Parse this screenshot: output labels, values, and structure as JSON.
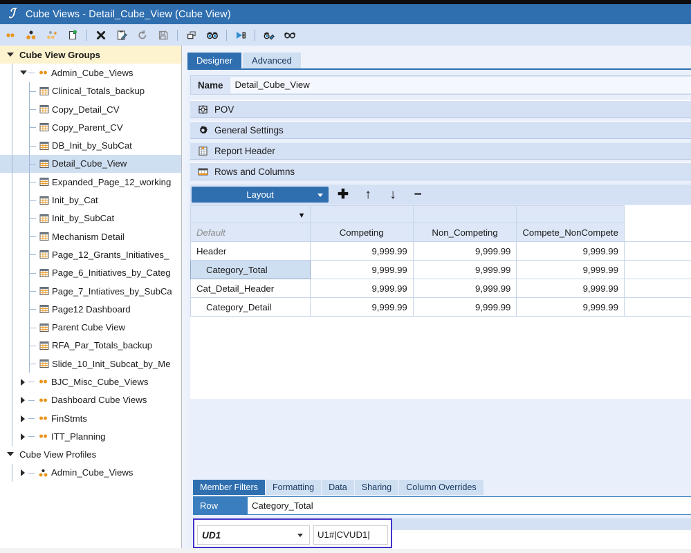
{
  "window": {
    "title": "Cube Views - Detail_Cube_View (Cube View)",
    "logo_glyph": "ℐ",
    "logo_icon": "onestream-logo-icon"
  },
  "toolbar": {
    "items": [
      {
        "name": "view-members-icon",
        "label": "View Members"
      },
      {
        "name": "cube-view-group-icon",
        "label": "Cube View Group"
      },
      {
        "name": "add-cube-view-group-icon",
        "label": "Add Cube View Group"
      },
      {
        "name": "new-cube-view-icon",
        "label": "New Cube View"
      },
      {
        "name": "delete-icon",
        "label": "Delete"
      },
      {
        "name": "edit-icon",
        "label": "Edit"
      },
      {
        "name": "refresh-icon",
        "label": "Refresh"
      },
      {
        "name": "save-icon",
        "label": "Save"
      },
      {
        "name": "copy-icon",
        "label": "Copy"
      },
      {
        "name": "find-icon",
        "label": "Find"
      },
      {
        "name": "execute-icon",
        "label": "Execute"
      },
      {
        "name": "search-settings-icon",
        "label": "Search Settings"
      },
      {
        "name": "view-icon",
        "label": "View"
      }
    ]
  },
  "tree": [
    {
      "label": "Cube View Groups",
      "depth": 0,
      "kind": "root",
      "state": "open",
      "selected": false
    },
    {
      "label": "Admin_Cube_Views",
      "depth": 1,
      "kind": "group",
      "state": "open",
      "selected": false
    },
    {
      "label": "Clinical_Totals_backup",
      "depth": 2,
      "kind": "view",
      "state": "leaf",
      "selected": false
    },
    {
      "label": "Copy_Detail_CV",
      "depth": 2,
      "kind": "view",
      "state": "leaf",
      "selected": false
    },
    {
      "label": "Copy_Parent_CV",
      "depth": 2,
      "kind": "view",
      "state": "leaf",
      "selected": false
    },
    {
      "label": "DB_Init_by_SubCat",
      "depth": 2,
      "kind": "view",
      "state": "leaf",
      "selected": false
    },
    {
      "label": "Detail_Cube_View",
      "depth": 2,
      "kind": "view",
      "state": "leaf",
      "selected": true
    },
    {
      "label": "Expanded_Page_12_working",
      "depth": 2,
      "kind": "view",
      "state": "leaf",
      "selected": false
    },
    {
      "label": "Init_by_Cat",
      "depth": 2,
      "kind": "view",
      "state": "leaf",
      "selected": false
    },
    {
      "label": "Init_by_SubCat",
      "depth": 2,
      "kind": "view",
      "state": "leaf",
      "selected": false
    },
    {
      "label": "Mechanism Detail",
      "depth": 2,
      "kind": "view",
      "state": "leaf",
      "selected": false
    },
    {
      "label": "Page_12_Grants_Initiatives_",
      "depth": 2,
      "kind": "view",
      "state": "leaf",
      "selected": false
    },
    {
      "label": "Page_6_Initiatives_by_Categ",
      "depth": 2,
      "kind": "view",
      "state": "leaf",
      "selected": false
    },
    {
      "label": "Page_7_Intiatives_by_SubCa",
      "depth": 2,
      "kind": "view",
      "state": "leaf",
      "selected": false
    },
    {
      "label": "Page12 Dashboard",
      "depth": 2,
      "kind": "view",
      "state": "leaf",
      "selected": false
    },
    {
      "label": "Parent Cube View",
      "depth": 2,
      "kind": "view",
      "state": "leaf",
      "selected": false
    },
    {
      "label": "RFA_Par_Totals_backup",
      "depth": 2,
      "kind": "view",
      "state": "leaf",
      "selected": false
    },
    {
      "label": "Slide_10_Init_Subcat_by_Me",
      "depth": 2,
      "kind": "view",
      "state": "leaf",
      "selected": false
    },
    {
      "label": "BJC_Misc_Cube_Views",
      "depth": 1,
      "kind": "group",
      "state": "closed",
      "selected": false
    },
    {
      "label": "Dashboard Cube Views",
      "depth": 1,
      "kind": "group",
      "state": "closed",
      "selected": false
    },
    {
      "label": "FinStmts",
      "depth": 1,
      "kind": "group",
      "state": "closed",
      "selected": false
    },
    {
      "label": "ITT_Planning",
      "depth": 1,
      "kind": "group",
      "state": "closed",
      "selected": false
    },
    {
      "label": "Cube View Profiles",
      "depth": 0,
      "kind": "rootplain",
      "state": "open",
      "selected": false
    },
    {
      "label": "Admin_Cube_Views",
      "depth": 1,
      "kind": "profile",
      "state": "closed",
      "selected": false
    }
  ],
  "tabs": [
    {
      "label": "Designer",
      "active": true
    },
    {
      "label": "Advanced",
      "active": false
    }
  ],
  "name_row": {
    "label": "Name",
    "value": "Detail_Cube_View"
  },
  "sections": [
    {
      "label": "POV",
      "icon": "pov-icon"
    },
    {
      "label": "General Settings",
      "icon": "gear-icon"
    },
    {
      "label": "Report Header",
      "icon": "report-header-icon"
    },
    {
      "label": "Rows and Columns",
      "icon": "rows-columns-icon"
    }
  ],
  "layout_bar": {
    "dropdown_label": "Layout",
    "buttons": [
      {
        "name": "add-row-button",
        "glyph": "✚"
      },
      {
        "name": "move-up-button",
        "glyph": "↑"
      },
      {
        "name": "move-down-button",
        "glyph": "↓"
      },
      {
        "name": "remove-row-button",
        "glyph": "−"
      }
    ]
  },
  "grid": {
    "filter_glyph": "▼",
    "row_header_label": "Default",
    "columns": [
      "Competing",
      "Non_Competing",
      "Compete_NonCompete"
    ],
    "rows": [
      {
        "label": "Header",
        "indent": false,
        "selected": false,
        "values": [
          "9,999.99",
          "9,999.99",
          "9,999.99"
        ]
      },
      {
        "label": "Category_Total",
        "indent": true,
        "selected": true,
        "values": [
          "9,999.99",
          "9,999.99",
          "9,999.99"
        ]
      },
      {
        "label": "Cat_Detail_Header",
        "indent": false,
        "selected": false,
        "values": [
          "9,999.99",
          "9,999.99",
          "9,999.99"
        ]
      },
      {
        "label": "Category_Detail",
        "indent": true,
        "selected": false,
        "values": [
          "9,999.99",
          "9,999.99",
          "9,999.99"
        ]
      }
    ]
  },
  "bottom": {
    "tabs": [
      {
        "label": "Member Filters",
        "active": true
      },
      {
        "label": "Formatting",
        "active": false
      },
      {
        "label": "Data",
        "active": false
      },
      {
        "label": "Sharing",
        "active": false
      },
      {
        "label": "Column Overrides",
        "active": false
      }
    ],
    "row_label": "Row",
    "row_value": "Category_Total",
    "dimension": "UD1",
    "expression": "U1#|CVUD1|"
  }
}
